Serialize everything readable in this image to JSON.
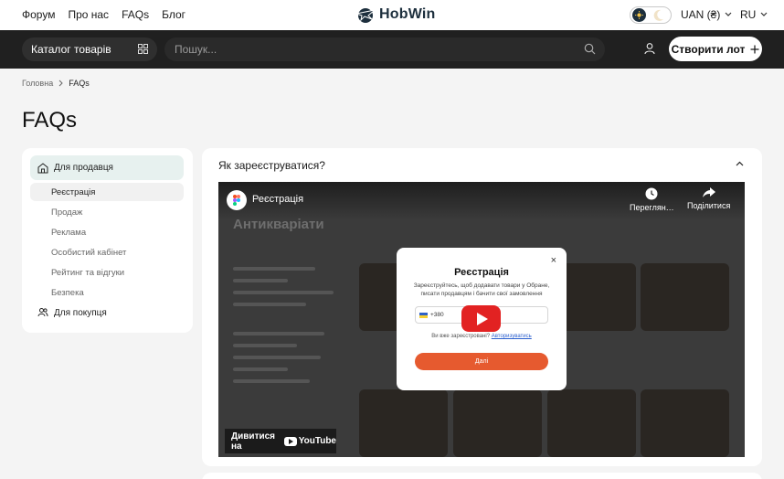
{
  "topnav": {
    "links": [
      "Форум",
      "Про нас",
      "FAQs",
      "Блог"
    ],
    "logo": "HobWin",
    "currency": "UAN (₴)",
    "language": "RU"
  },
  "bar": {
    "catalog": "Каталог товарів",
    "search_placeholder": "Пошук...",
    "create_lot": "Створити лот"
  },
  "breadcrumb": {
    "home": "Головна",
    "current": "FAQs"
  },
  "page_title": "FAQs",
  "sidebar": {
    "seller": "Для продавця",
    "items": [
      "Реєстрація",
      "Продаж",
      "Реклама",
      "Особистий кабінет",
      "Рейтинг та відгуки",
      "Безпека"
    ],
    "buyer": "Для покупця"
  },
  "faq": {
    "question": "Як зареєструватися?",
    "video": {
      "title": "Реєстрація",
      "watch_later": "Переглян…",
      "share": "Поділитися",
      "watch_on": "Дивитися на",
      "youtube": "YouTube",
      "bg_heading": "Антикваріати",
      "modal": {
        "title": "Реєстрація",
        "subtitle": "Зареєструйтесь, щоб додавати товари у Обране, писати продавцям і бачити свої замовлення",
        "phone_code": "+380",
        "registered_q": "Ви вже зареєстровані?",
        "login_link": "Авторизуватись",
        "next": "Далі",
        "close": "×"
      }
    }
  },
  "colors": {
    "accent": "#e65a2f",
    "dark_bar": "#202020",
    "active_bg": "#e7f1ef"
  }
}
